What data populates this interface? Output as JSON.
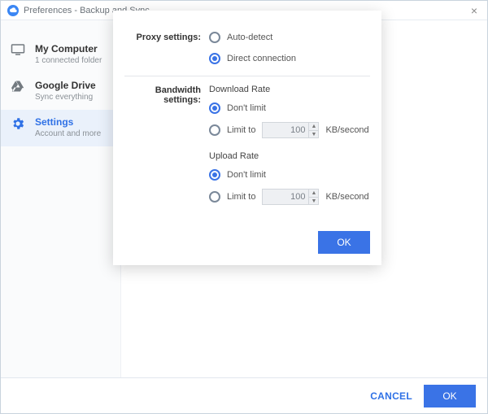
{
  "titlebar": {
    "text": "Preferences - Backup and Sync"
  },
  "sidebar": {
    "items": [
      {
        "title": "My Computer",
        "subtitle": "1 connected folder"
      },
      {
        "title": "Google Drive",
        "subtitle": "Sync everything"
      },
      {
        "title": "Settings",
        "subtitle": "Account and more"
      }
    ]
  },
  "dialog": {
    "proxy": {
      "label": "Proxy settings:",
      "auto": "Auto-detect",
      "direct": "Direct connection"
    },
    "bandwidth": {
      "label": "Bandwidth settings:",
      "download": {
        "title": "Download Rate",
        "dont": "Don't limit",
        "limit": "Limit to",
        "value": "100",
        "unit": "KB/second"
      },
      "upload": {
        "title": "Upload Rate",
        "dont": "Don't limit",
        "limit": "Limit to",
        "value": "100",
        "unit": "KB/second"
      }
    },
    "ok": "OK"
  },
  "footer": {
    "cancel": "CANCEL",
    "ok": "OK"
  }
}
